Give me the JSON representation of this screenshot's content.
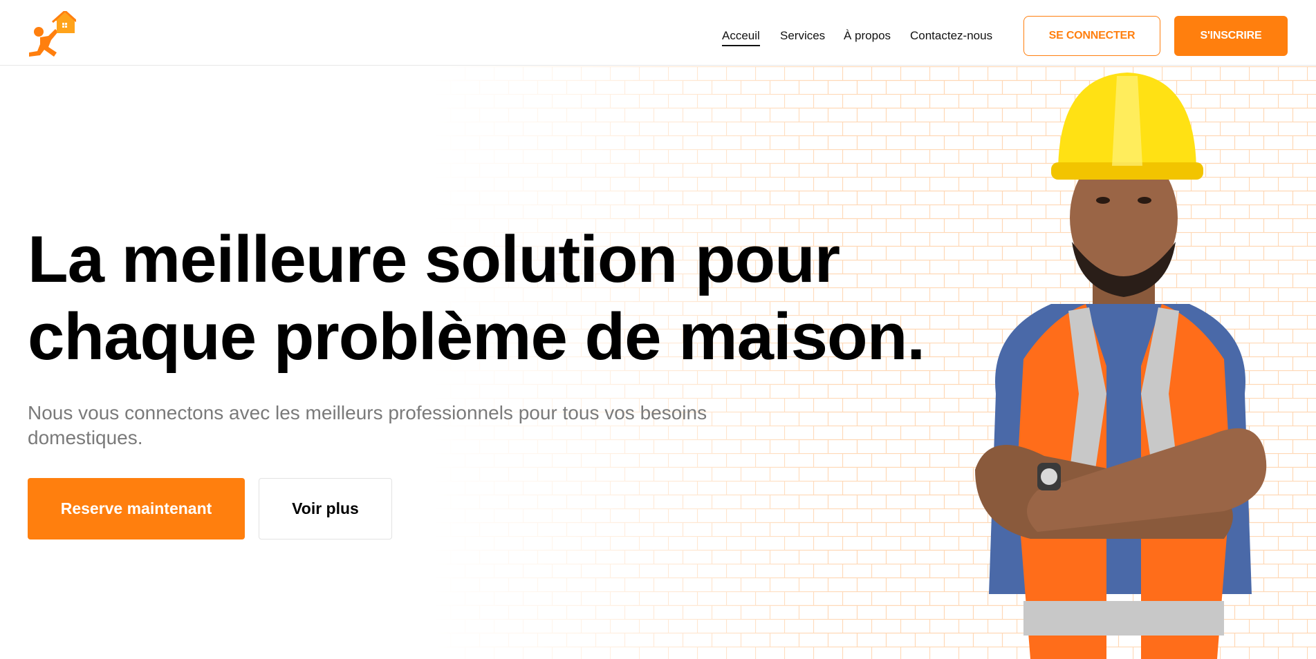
{
  "header": {
    "logo_icon": "house-carrier-logo-icon",
    "nav": [
      {
        "label": "Acceuil",
        "active": true
      },
      {
        "label": "Services",
        "active": false
      },
      {
        "label": "À propos",
        "active": false
      },
      {
        "label": "Contactez-nous",
        "active": false
      }
    ],
    "login_label": "SE CONNECTER",
    "signup_label": "S'INSCRIRE"
  },
  "hero": {
    "title_line1": "La meilleure solution pour",
    "title_line2": "chaque problème de maison.",
    "subtitle": "Nous vous connectons avec les meilleurs professionnels pour tous vos besoins domestiques.",
    "reserve_label": "Reserve maintenant",
    "more_label": "Voir plus",
    "image_subject": "construction-worker-with-hard-hat"
  },
  "colors": {
    "accent": "#ff7f0e",
    "text": "#000000",
    "muted": "#7a7a7a",
    "helmet": "#ffe114",
    "vest": "#ff6d1a",
    "shirt": "#4a69a8"
  }
}
